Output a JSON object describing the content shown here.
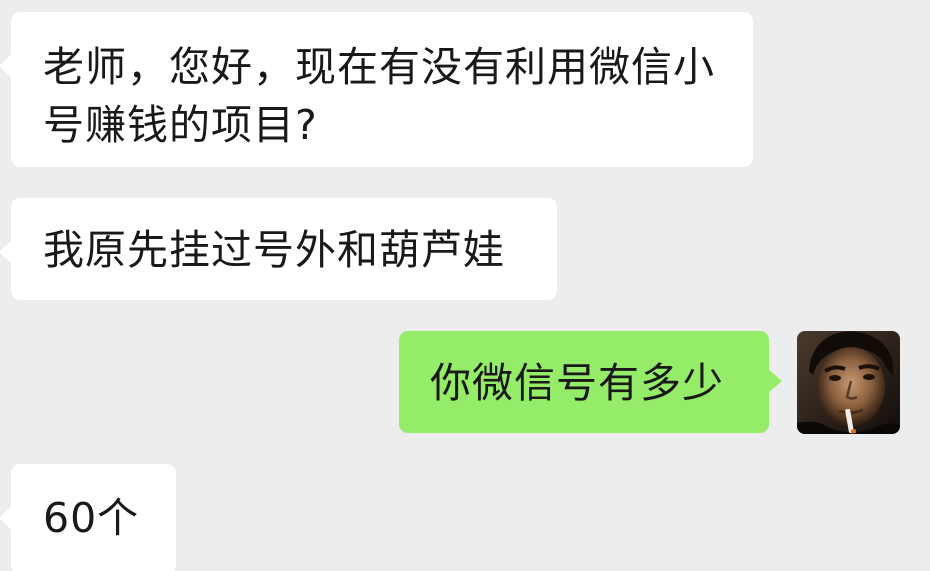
{
  "messages": [
    {
      "side": "in",
      "text": "老师，您好，现在有没有利用微信小号赚钱的项目?"
    },
    {
      "side": "in",
      "text": "我原先挂过号外和葫芦娃"
    },
    {
      "side": "out",
      "text": "你微信号有多少"
    },
    {
      "side": "in",
      "text": "60个"
    }
  ],
  "colors": {
    "background": "#ededed",
    "incoming_bubble": "#ffffff",
    "outgoing_bubble": "#95ec69",
    "text": "#191919"
  },
  "icons": {
    "avatar": "user-avatar-photo-icon"
  }
}
